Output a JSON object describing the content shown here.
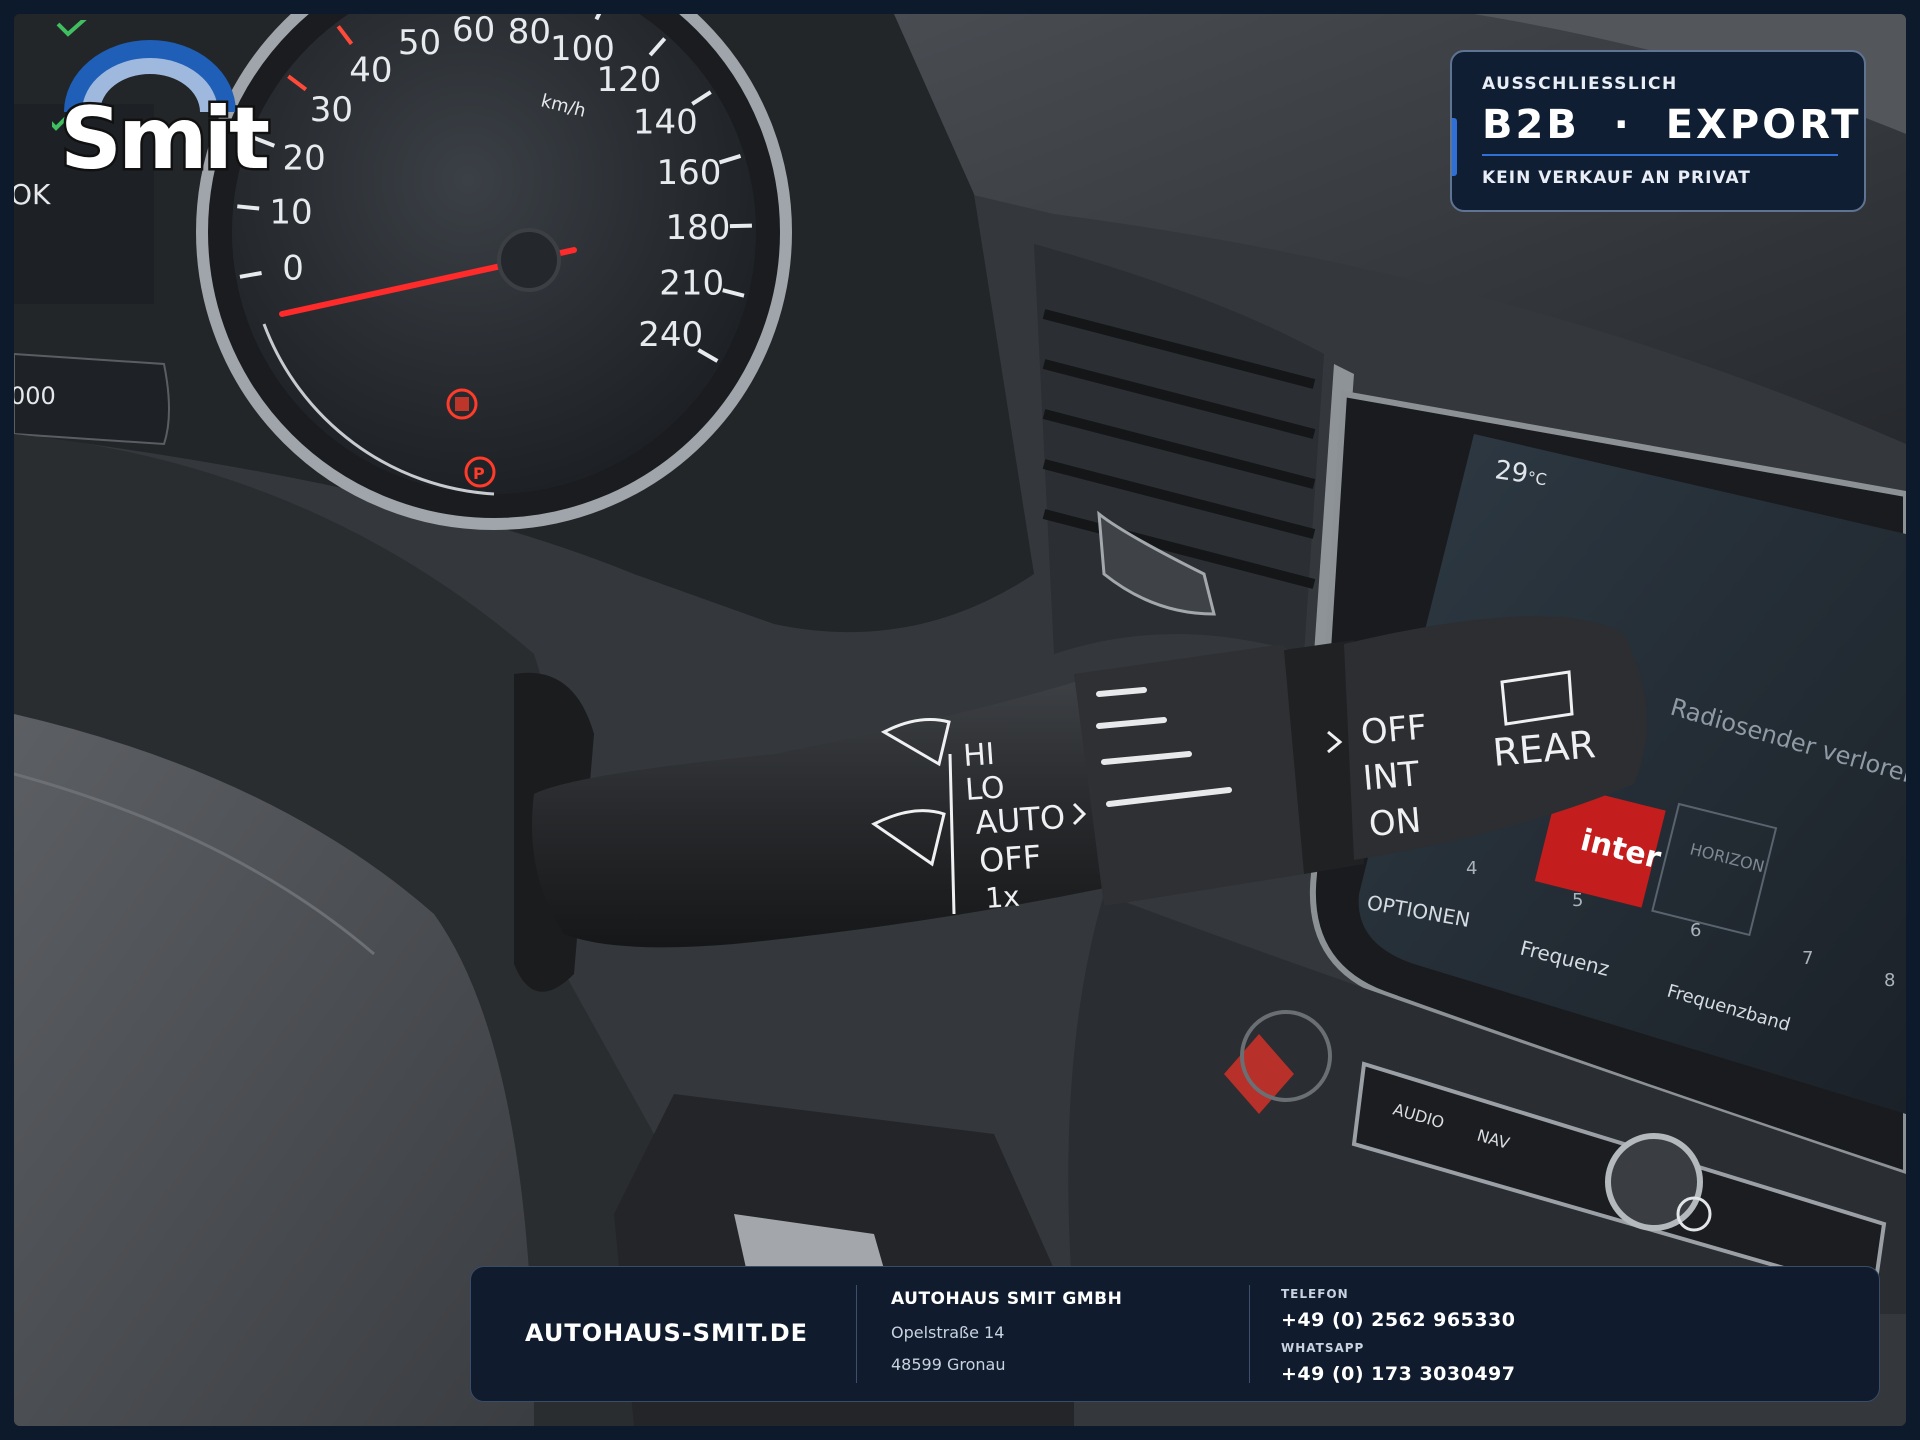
{
  "watermark": {
    "logo_text": "Smit"
  },
  "badge": {
    "top_line": "AUSSCHLIESSLICH",
    "headline": "B2B  ·  EXPORT",
    "bottom_line": "KEIN VERKAUF AN PRIVAT",
    "accent_color": "#2f6fd6"
  },
  "footer": {
    "website": "AUTOHAUS-SMIT.DE",
    "company": "AUTOHAUS SMIT GMBH",
    "street": "Opelstraße 14",
    "city": "48599 Gronau",
    "phone_label": "TELEFON",
    "phone": "+49 (0) 2562 965330",
    "whatsapp_label": "WHATSAPP",
    "whatsapp": "+49 (0) 173 3030497"
  },
  "speedometer": {
    "unit": "km/h",
    "ticks": [
      "0",
      "10",
      "20",
      "30",
      "40",
      "50",
      "60",
      "80",
      "100",
      "120",
      "140",
      "160",
      "180",
      "210",
      "240"
    ],
    "needle_value": 0,
    "partial_left_labels": [
      "OK",
      "000"
    ]
  },
  "wiper_stalk": {
    "front_labels": [
      "HI",
      "LO",
      "AUTO",
      "OFF",
      "1x"
    ],
    "rear_ring_labels": [
      "OFF",
      "INT",
      "ON"
    ],
    "rear_label": "REAR"
  },
  "infotainment": {
    "temperature": "29",
    "temperature_unit": "°C",
    "header_text": "Radiosender verloren",
    "menu_items": [
      "OPTIONEN",
      "Frequenz",
      "Frequenzband"
    ],
    "preset_numbers": [
      "4",
      "5",
      "6",
      "7",
      "8"
    ],
    "preset_names": [
      "inter",
      "HORIZON"
    ],
    "buttons": [
      "AUDIO",
      "NAV"
    ]
  }
}
